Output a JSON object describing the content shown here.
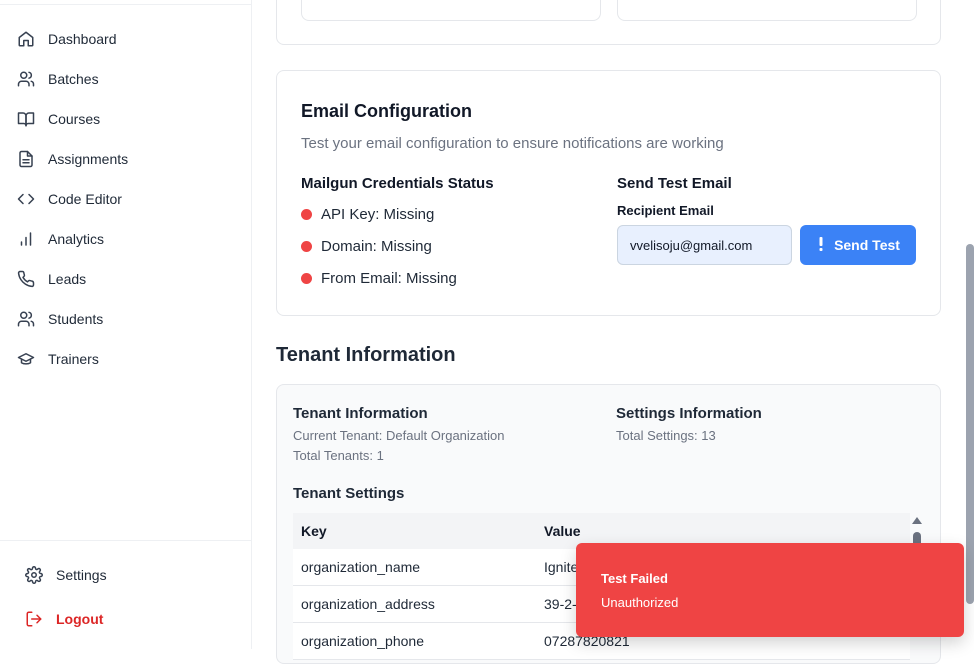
{
  "sidebar": {
    "items": [
      {
        "label": "Dashboard",
        "icon": "home-icon"
      },
      {
        "label": "Batches",
        "icon": "users-icon"
      },
      {
        "label": "Courses",
        "icon": "book-open-icon"
      },
      {
        "label": "Assignments",
        "icon": "file-text-icon"
      },
      {
        "label": "Code Editor",
        "icon": "code-icon"
      },
      {
        "label": "Analytics",
        "icon": "bar-chart-icon"
      },
      {
        "label": "Leads",
        "icon": "phone-icon"
      },
      {
        "label": "Students",
        "icon": "users-icon"
      },
      {
        "label": "Trainers",
        "icon": "graduation-cap-icon"
      }
    ],
    "settings_label": "Settings",
    "logout_label": "Logout"
  },
  "email_config": {
    "title": "Email Configuration",
    "subtitle": "Test your email configuration to ensure notifications are working",
    "credentials_title": "Mailgun Credentials Status",
    "statuses": [
      "API Key: Missing",
      "Domain: Missing",
      "From Email: Missing"
    ],
    "send_title": "Send Test Email",
    "recipient_label": "Recipient Email",
    "recipient_value": "vvelisoju@gmail.com",
    "send_button": "Send Test",
    "status_color": "#ef4444"
  },
  "tenant": {
    "section_title": "Tenant Information",
    "info_title": "Tenant Information",
    "current_tenant": "Current Tenant: Default Organization",
    "total_tenants": "Total Tenants: 1",
    "settings_title": "Settings Information",
    "total_settings": "Total Settings: 13",
    "table_title": "Tenant Settings",
    "columns": [
      "Key",
      "Value"
    ],
    "rows": [
      {
        "key": "organization_name",
        "value": "Ignite"
      },
      {
        "key": "organization_address",
        "value": "39-2-"
      },
      {
        "key": "organization_phone",
        "value": "07287820821"
      }
    ]
  },
  "toast": {
    "title": "Test Failed",
    "message": "Unauthorized",
    "color": "#ef4444"
  }
}
